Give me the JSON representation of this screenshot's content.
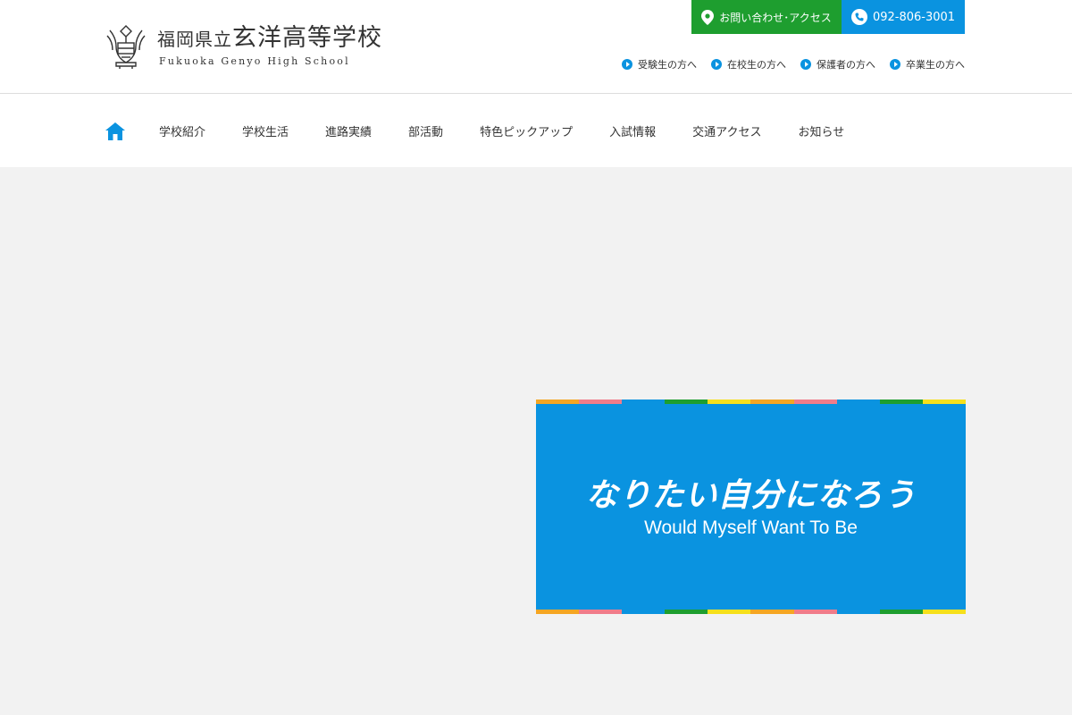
{
  "header": {
    "logo": {
      "prefecture": "福岡県立",
      "school": "玄洋高等学校",
      "english": "Fukuoka Genyo High School"
    },
    "contact_button": {
      "label": "お問い合わせ･アクセス",
      "icon": "map-pin-icon",
      "color": "#1e9e2f"
    },
    "phone_button": {
      "label": "092-806-3001",
      "icon": "phone-icon",
      "color": "#0a93e0"
    },
    "audience_links": [
      {
        "label": "受験生の方へ"
      },
      {
        "label": "在校生の方へ"
      },
      {
        "label": "保護者の方へ"
      },
      {
        "label": "卒業生の方へ"
      }
    ]
  },
  "nav": {
    "home_icon": "home-icon",
    "items": [
      {
        "label": "学校紹介"
      },
      {
        "label": "学校生活"
      },
      {
        "label": "進路実績"
      },
      {
        "label": "部活動"
      },
      {
        "label": "特色ピックアップ"
      },
      {
        "label": "入試情報"
      },
      {
        "label": "交通アクセス"
      },
      {
        "label": "お知らせ"
      }
    ]
  },
  "banner": {
    "tagline_jp": "なりたい自分になろう",
    "tagline_en": "Would Myself Want To Be",
    "background": "#0a93e0",
    "stripe_colors": [
      "#f5a623",
      "#f07c8a",
      "#0a93e0",
      "#1e9e2f",
      "#f6e01c",
      "#f5a623",
      "#f07c8a",
      "#0a93e0",
      "#1e9e2f",
      "#f6e01c"
    ]
  },
  "colors": {
    "accent_blue": "#0a93e0",
    "accent_green": "#1e9e2f",
    "background_gray": "#f2f2f2"
  }
}
